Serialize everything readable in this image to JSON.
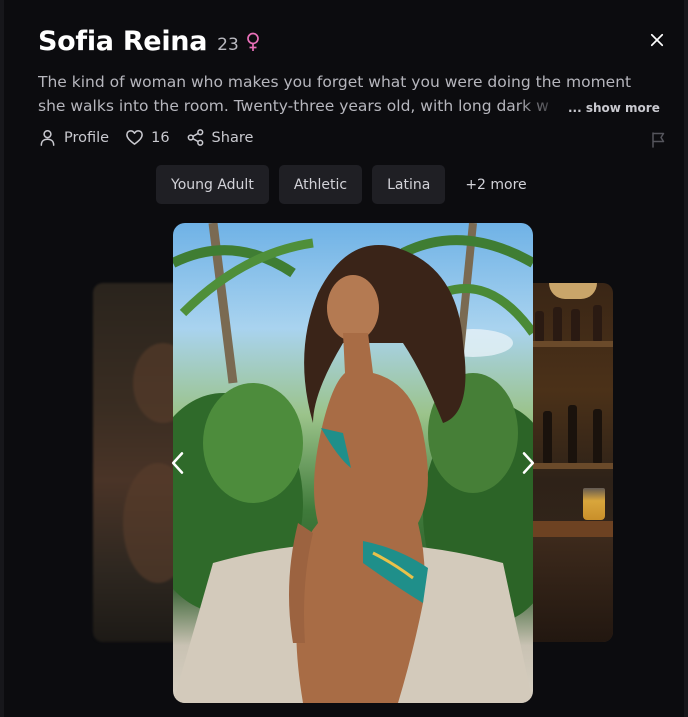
{
  "profile": {
    "name": "Sofia Reina",
    "age": "23",
    "gender_icon": "female-symbol-icon",
    "gender_color": "#e870b8",
    "description_line1": "The kind of woman who makes you forget what you were doing the moment",
    "description_line2": "she walks into the room. Twenty-three years old, with long dark w",
    "show_more_label": "... show more"
  },
  "actions": {
    "profile_label": "Profile",
    "likes_count": "16",
    "share_label": "Share"
  },
  "tags": [
    "Young Adult",
    "Athletic",
    "Latina"
  ],
  "tags_more_label": "+2 more",
  "gallery": {
    "current_image": "woman-in-floral-bikini-on-tropical-path",
    "prev_image": "blurred-portrait",
    "next_image": "bar-with-bottles"
  },
  "colors": {
    "background": "#0c0c0f",
    "tag_background": "#1f1f24",
    "text_primary": "#ffffff",
    "text_secondary": "#b6b6bd"
  }
}
